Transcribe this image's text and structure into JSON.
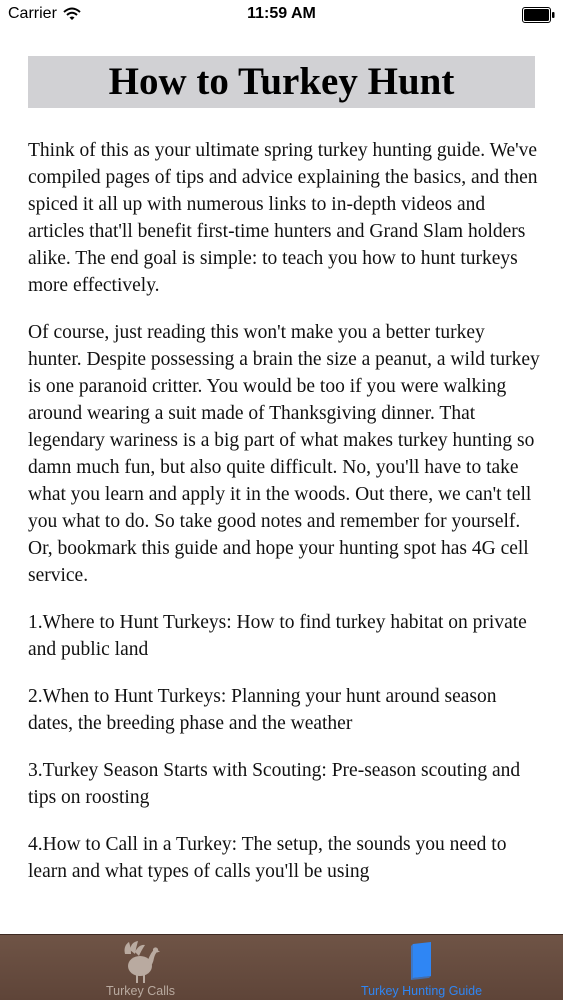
{
  "status_bar": {
    "carrier": "Carrier",
    "time": "11:59 AM"
  },
  "page": {
    "title": "How to Turkey Hunt",
    "paragraphs": [
      "Think of this as your ultimate spring turkey hunting guide. We've compiled pages of tips and advice explaining the basics, and then spiced it all up with numerous links to in-depth videos and articles that'll benefit first-time hunters and Grand Slam holders alike. The end goal is simple: to teach you how to hunt turkeys more effectively.",
      "Of course, just reading this won't make you a better turkey hunter. Despite possessing a brain the size a peanut, a wild turkey is one paranoid critter. You would be too if you were walking around wearing a suit made of Thanksgiving dinner. That legendary wariness is a big part of what makes turkey hunting so damn much fun, but also quite difficult. No, you'll have to take what you learn and apply it in the woods. Out there, we can't tell you what to do. So take good notes and remember for yourself. Or, bookmark this guide and hope your hunting spot has 4G cell service.",
      "1.Where to Hunt Turkeys: How to find turkey habitat on private and public land",
      "2.When to Hunt Turkeys: Planning your hunt around season dates, the breeding phase and the weather",
      "3.Turkey Season Starts with Scouting: Pre-season scouting and tips on roosting",
      "4.How to Call in a Turkey: The setup, the sounds you need to learn and what types of calls you'll be using"
    ]
  },
  "tab_bar": {
    "tabs": [
      {
        "label": "Turkey Calls",
        "icon": "turkey-icon",
        "selected": false
      },
      {
        "label": "Turkey Hunting Guide",
        "icon": "book-icon",
        "selected": true
      }
    ],
    "colors": {
      "background": "#654a3d",
      "inactive": "#b9aaa0",
      "active": "#2f86f4"
    }
  }
}
